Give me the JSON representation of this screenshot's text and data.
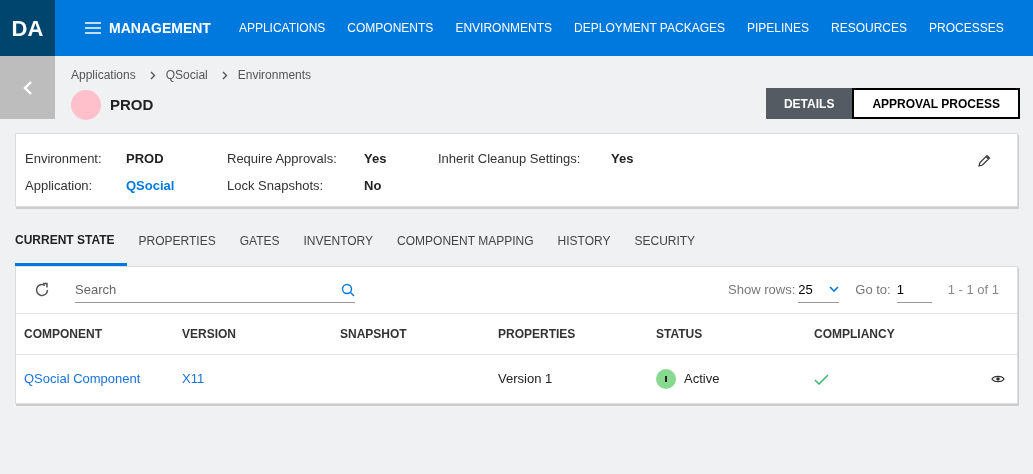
{
  "logo": "DA",
  "nav": {
    "menu_label": "MANAGEMENT",
    "items": [
      {
        "label": "APPLICATIONS"
      },
      {
        "label": "COMPONENTS"
      },
      {
        "label": "ENVIRONMENTS"
      },
      {
        "label": "DEPLOYMENT PACKAGES"
      },
      {
        "label": "PIPELINES"
      },
      {
        "label": "RESOURCES"
      },
      {
        "label": "PROCESSES"
      }
    ]
  },
  "breadcrumb": [
    "Applications",
    "QSocial",
    "Environments"
  ],
  "title": "PROD",
  "view_buttons": [
    {
      "label": "DETAILS",
      "selected": true
    },
    {
      "label": "APPROVAL PROCESS",
      "selected": false
    }
  ],
  "info": {
    "columns": [
      [
        {
          "label": "Environment:",
          "value": "PROD",
          "kind": "text"
        },
        {
          "label": "Application:",
          "value": "QSocial",
          "kind": "link"
        }
      ],
      [
        {
          "label": "Require Approvals:",
          "value": "Yes",
          "kind": "text"
        },
        {
          "label": "Lock Snapshots:",
          "value": "No",
          "kind": "text"
        }
      ],
      [
        {
          "label": "Inherit Cleanup Settings:",
          "value": "Yes",
          "kind": "text"
        }
      ]
    ]
  },
  "tabs": [
    {
      "label": "CURRENT STATE",
      "selected": true
    },
    {
      "label": "PROPERTIES",
      "selected": false
    },
    {
      "label": "GATES",
      "selected": false
    },
    {
      "label": "INVENTORY",
      "selected": false
    },
    {
      "label": "COMPONENT MAPPING",
      "selected": false
    },
    {
      "label": "HISTORY",
      "selected": false
    },
    {
      "label": "SECURITY",
      "selected": false
    }
  ],
  "toolbar": {
    "search": {
      "placeholder": "Search"
    },
    "show_rows_label": "Show rows:",
    "show_rows_value": "25",
    "goto_label": "Go to:",
    "goto_value": "1",
    "range": "1 - 1 of 1"
  },
  "table": {
    "columns": [
      "COMPONENT",
      "VERSION",
      "SNAPSHOT",
      "PROPERTIES",
      "STATUS",
      "COMPLIANCY"
    ],
    "rows": [
      {
        "component": "QSocial Component",
        "version": "X11",
        "snapshot": "",
        "properties": "Version 1",
        "status": "Active",
        "compliant": true
      }
    ]
  }
}
